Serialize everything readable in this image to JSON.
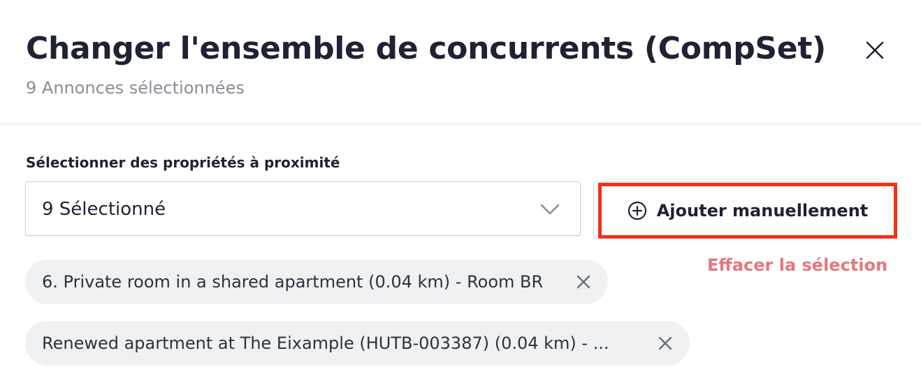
{
  "dialog": {
    "title": "Changer l'ensemble de concurrents (CompSet)",
    "subtitle": "9 Annonces sélectionnées",
    "close_icon": "close-icon"
  },
  "nearby": {
    "label": "Sélectionner des propriétés à proximité",
    "selected_value": "9 Sélectionné",
    "dropdown_icon": "chevron-down-icon"
  },
  "actions": {
    "add_manual_label": "Ajouter manuellement",
    "add_icon": "plus-circle-icon",
    "clear_label": "Effacer la sélection"
  },
  "chips": [
    {
      "label": "6. Private room in a shared apartment (0.04 km) - Room BR"
    },
    {
      "label": "Renewed apartment at The Eixample (HUTB-003387) (0.04 km) - ..."
    }
  ],
  "colors": {
    "highlight": "#f2311b",
    "clear_link": "#e8767c",
    "chip_bg": "#f0f1f3"
  }
}
